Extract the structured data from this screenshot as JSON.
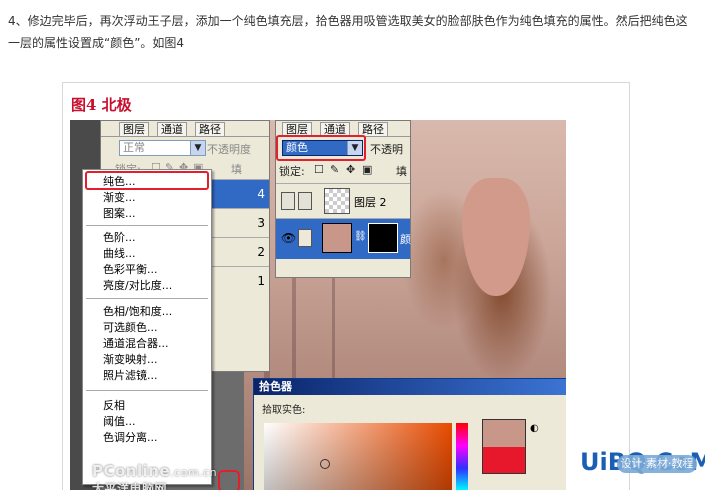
{
  "intro_text": "4、修边完毕后，再次浮动王子层，添加一个纯色填充层，拾色器用吸管选取美女的脸部肤色作为纯色填充的属性。然后把纯色这一层的属性设置成“颜色”。如图4",
  "figure_title": "图4  北极",
  "layers_panel_back": {
    "tabs": [
      "图层",
      "通道",
      "路径"
    ],
    "blend_mode": "正常",
    "opacity_label": "不透明度",
    "lock_label": "锁定:",
    "fill_label": "填",
    "layer_numbers": [
      "4",
      "3",
      "2",
      "1"
    ]
  },
  "context_menu": {
    "items_group1": [
      "纯色...",
      "渐变...",
      "图案..."
    ],
    "items_group2": [
      "色阶...",
      "曲线...",
      "色彩平衡...",
      "亮度/对比度..."
    ],
    "items_group3": [
      "色相/饱和度...",
      "可选颜色...",
      "通道混合器...",
      "渐变映射...",
      "照片滤镜..."
    ],
    "items_group4": [
      "反相",
      "阈值...",
      "色调分离..."
    ],
    "highlighted": "纯色..."
  },
  "layers_panel_front": {
    "tabs": [
      "图层",
      "通道",
      "路径"
    ],
    "blend_mode": "颜色",
    "opacity_label": "不透明",
    "lock_label": "锁定:",
    "fill_label": "填",
    "layer2_name": "图层 2",
    "fill_layer_name_fragment": "颜"
  },
  "color_picker": {
    "title": "拾色器",
    "label": "拾取实色:",
    "new_color": "#c9968a",
    "old_color": "#e8182c"
  },
  "watermarks": {
    "pconline_a": "PConline",
    "pconline_b": ".com.cn",
    "pconline_cn": "太平洋电脑网",
    "site": "UiBQ.CoM",
    "site_badge": "设计·素材·教程"
  },
  "colors": {
    "title_red": "#c8102e",
    "selection_blue": "#316ac5",
    "highlight_red": "#e0202c",
    "skin": "#d19a8a"
  }
}
